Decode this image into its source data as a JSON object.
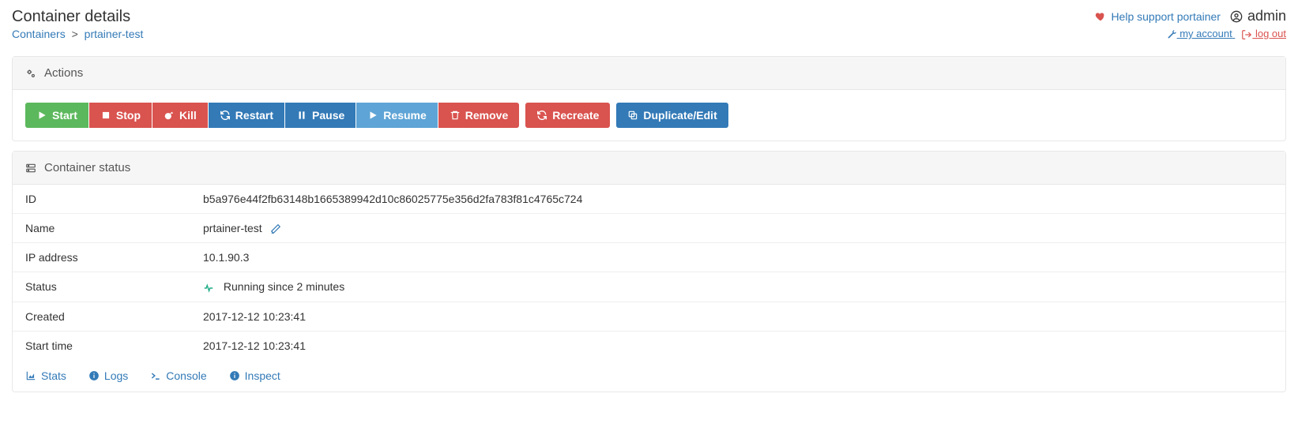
{
  "page": {
    "title": "Container details"
  },
  "breadcrumb": {
    "root": "Containers",
    "current": "prtainer-test"
  },
  "header": {
    "help_label": "Help support portainer",
    "username": "admin",
    "my_account": "my account",
    "log_out": "log out"
  },
  "panels": {
    "actions_title": "Actions",
    "status_title": "Container status"
  },
  "actions": {
    "start": "Start",
    "stop": "Stop",
    "kill": "Kill",
    "restart": "Restart",
    "pause": "Pause",
    "resume": "Resume",
    "remove": "Remove",
    "recreate": "Recreate",
    "duplicate": "Duplicate/Edit"
  },
  "status": {
    "labels": {
      "id": "ID",
      "name": "Name",
      "ip": "IP address",
      "status": "Status",
      "created": "Created",
      "start_time": "Start time"
    },
    "id": "b5a976e44f2fb63148b1665389942d10c86025775e356d2fa783f81c4765c724",
    "name": "prtainer-test",
    "ip": "10.1.90.3",
    "running": "Running since 2 minutes",
    "created": "2017-12-12 10:23:41",
    "start_time": "2017-12-12 10:23:41"
  },
  "footer": {
    "stats": "Stats",
    "logs": "Logs",
    "console": "Console",
    "inspect": "Inspect"
  }
}
